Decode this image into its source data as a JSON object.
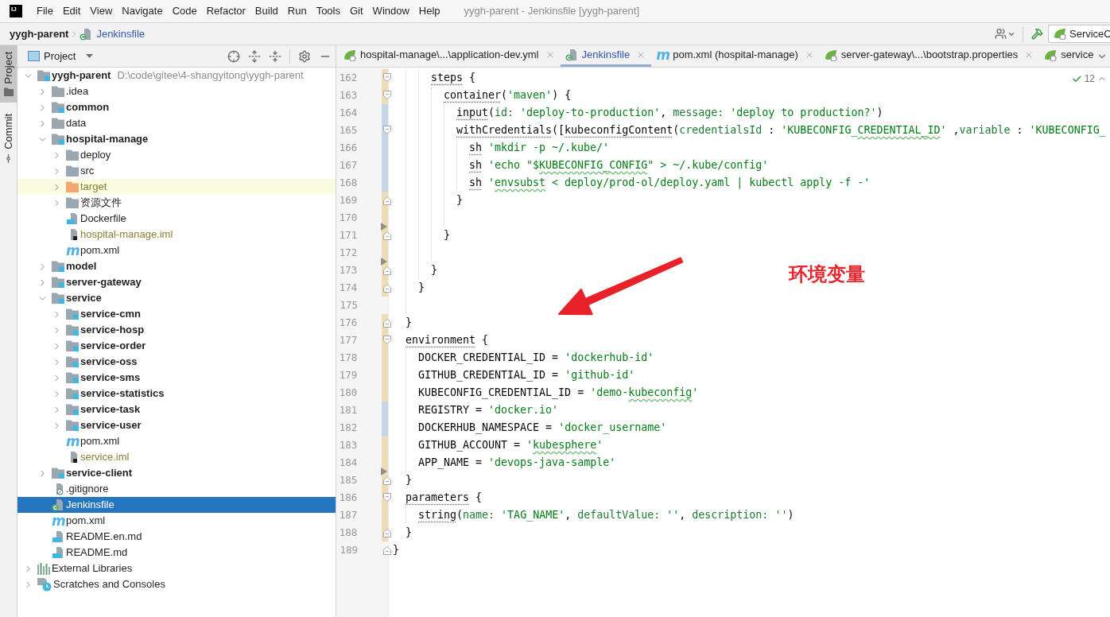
{
  "window": {
    "logo": "IJ",
    "title": "yygh-parent - Jenkinsfile [yygh-parent]"
  },
  "menu": [
    "File",
    "Edit",
    "View",
    "Navigate",
    "Code",
    "Refactor",
    "Build",
    "Run",
    "Tools",
    "Git",
    "Window",
    "Help"
  ],
  "breadcrumb": {
    "project": "yygh-parent",
    "file": {
      "label": "Jenkinsfile",
      "kind": "jenkins",
      "modified": true
    }
  },
  "run_config": {
    "label": "ServiceC"
  },
  "tool_windows": [
    {
      "label": "Project",
      "kind": "project",
      "selected": true
    },
    {
      "label": "Commit",
      "kind": "commit",
      "selected": false
    }
  ],
  "project_panel": {
    "title": "Project",
    "tree": [
      {
        "name": "yygh-parent",
        "path": "D:\\code\\gitee\\4-shangyitong\\yygh-parent",
        "kind": "module",
        "expanded": true,
        "selected": false,
        "ignored": false,
        "children": [
          {
            "name": ".idea",
            "kind": "folder",
            "expanded": false,
            "selected": false,
            "ignored": false
          },
          {
            "name": "common",
            "kind": "module",
            "expanded": false,
            "selected": false,
            "ignored": false
          },
          {
            "name": "data",
            "kind": "folder",
            "expanded": false,
            "selected": false,
            "ignored": false
          },
          {
            "name": "hospital-manage",
            "kind": "module",
            "expanded": true,
            "selected": false,
            "ignored": false,
            "children": [
              {
                "name": "deploy",
                "kind": "folder",
                "expanded": false,
                "selected": false,
                "ignored": false
              },
              {
                "name": "src",
                "kind": "folder",
                "expanded": false,
                "selected": false,
                "ignored": false
              },
              {
                "name": "target",
                "kind": "excluded",
                "expanded": false,
                "selected": false,
                "ignored": true
              },
              {
                "name": "资源文件",
                "kind": "folder",
                "expanded": false,
                "selected": false,
                "ignored": false
              },
              {
                "name": "Dockerfile",
                "kind": "dockerfile",
                "selected": false,
                "ignored": false
              },
              {
                "name": "hospital-manage.iml",
                "kind": "iml",
                "selected": false,
                "ignored": true
              },
              {
                "name": "pom.xml",
                "kind": "maven",
                "glyph": "m",
                "selected": false,
                "ignored": false
              }
            ]
          },
          {
            "name": "model",
            "kind": "module",
            "expanded": false,
            "selected": false,
            "ignored": false
          },
          {
            "name": "server-gateway",
            "kind": "module",
            "expanded": false,
            "selected": false,
            "ignored": false
          },
          {
            "name": "service",
            "kind": "module",
            "expanded": true,
            "selected": false,
            "ignored": false,
            "children": [
              {
                "name": "service-cmn",
                "kind": "module",
                "expanded": false,
                "selected": false,
                "ignored": false
              },
              {
                "name": "service-hosp",
                "kind": "module",
                "expanded": false,
                "selected": false,
                "ignored": false
              },
              {
                "name": "service-order",
                "kind": "module",
                "expanded": false,
                "selected": false,
                "ignored": false
              },
              {
                "name": "service-oss",
                "kind": "module",
                "expanded": false,
                "selected": false,
                "ignored": false
              },
              {
                "name": "service-sms",
                "kind": "module",
                "expanded": false,
                "selected": false,
                "ignored": false
              },
              {
                "name": "service-statistics",
                "kind": "module",
                "expanded": false,
                "selected": false,
                "ignored": false
              },
              {
                "name": "service-task",
                "kind": "module",
                "expanded": false,
                "selected": false,
                "ignored": false
              },
              {
                "name": "service-user",
                "kind": "module",
                "expanded": false,
                "selected": false,
                "ignored": false
              },
              {
                "name": "pom.xml",
                "kind": "maven",
                "glyph": "m",
                "selected": false,
                "ignored": false
              },
              {
                "name": "service.iml",
                "kind": "iml",
                "selected": false,
                "ignored": true
              }
            ]
          },
          {
            "name": "service-client",
            "kind": "module",
            "expanded": false,
            "selected": false,
            "ignored": false
          },
          {
            "name": ".gitignore",
            "kind": "gitignore",
            "selected": false,
            "ignored": false
          },
          {
            "name": "Jenkinsfile",
            "kind": "jenkins",
            "selected": true,
            "ignored": false
          },
          {
            "name": "pom.xml",
            "kind": "maven",
            "glyph": "m",
            "selected": false,
            "ignored": false
          },
          {
            "name": "README.en.md",
            "kind": "markdown",
            "selected": false,
            "ignored": false
          },
          {
            "name": "README.md",
            "kind": "markdown",
            "selected": false,
            "ignored": false
          }
        ]
      },
      {
        "name": "External Libraries",
        "kind": "libraries",
        "expanded": false,
        "selected": false,
        "ignored": false
      },
      {
        "name": "Scratches and Consoles",
        "kind": "scratches",
        "expanded": false,
        "selected": false,
        "ignored": false
      }
    ]
  },
  "editor": {
    "tabs": [
      {
        "label": "hospital-manage\\...\\application-dev.yml",
        "kind": "spring",
        "selected": false,
        "modified": false,
        "closable": true
      },
      {
        "label": "Jenkinsfile",
        "kind": "jenkins",
        "selected": true,
        "modified": true,
        "closable": true
      },
      {
        "label": "pom.xml (hospital-manage)",
        "kind": "maven",
        "glyph": "m",
        "selected": false,
        "modified": false,
        "closable": true
      },
      {
        "label": "server-gateway\\...\\bootstrap.properties",
        "kind": "spring",
        "selected": false,
        "modified": false,
        "closable": true
      },
      {
        "label": "service",
        "kind": "spring",
        "selected": false,
        "modified": false,
        "closable": false
      }
    ],
    "inspections": "12",
    "lines": [
      {
        "number": "162",
        "color": "#eddcb5",
        "fold": {
          "kind": "start"
        },
        "marker": false,
        "tokens": [
          {
            "kind": "keyword",
            "text": "      steps"
          },
          {
            "kind": "plain",
            "text": " {"
          }
        ]
      },
      {
        "number": "163",
        "color": "#eddcb5",
        "fold": {
          "kind": "start"
        },
        "marker": false,
        "tokens": [
          {
            "kind": "keyword",
            "text": "        container"
          },
          {
            "kind": "plain",
            "text": "("
          },
          {
            "kind": "string",
            "text": "'maven'"
          },
          {
            "kind": "plain",
            "text": ") {"
          }
        ]
      },
      {
        "number": "164",
        "color": "#c5d6e8",
        "marker": false,
        "tokens": [
          {
            "kind": "keyword",
            "text": "          input"
          },
          {
            "kind": "plain",
            "text": "("
          },
          {
            "kind": "param",
            "text": "id: "
          },
          {
            "kind": "string",
            "text": "'deploy-to-production'"
          },
          {
            "kind": "plain",
            "text": ", "
          },
          {
            "kind": "param",
            "text": "message: "
          },
          {
            "kind": "string",
            "text": "'deploy to production?'"
          },
          {
            "kind": "plain",
            "text": ")"
          }
        ]
      },
      {
        "number": "165",
        "color": "#c5d6e8",
        "fold": {
          "kind": "start"
        },
        "marker": false,
        "tokens": [
          {
            "kind": "keyword",
            "text": "          withCredentials"
          },
          {
            "kind": "plain",
            "text": "(["
          },
          {
            "kind": "keyword",
            "text": "kubeconfigContent"
          },
          {
            "kind": "plain",
            "text": "("
          },
          {
            "kind": "param",
            "text": "credentialsId"
          },
          {
            "kind": "plain",
            "text": " : "
          },
          {
            "kind": "string",
            "text": "'KUBECONFIG_"
          },
          {
            "kind": "typo",
            "text": "CREDENTIAL_ID"
          },
          {
            "kind": "string",
            "text": "'"
          },
          {
            "kind": "plain",
            "text": " ,"
          },
          {
            "kind": "param",
            "text": "variable"
          },
          {
            "kind": "plain",
            "text": " : "
          },
          {
            "kind": "string",
            "text": "'KUBECONFIG_"
          }
        ]
      },
      {
        "number": "166",
        "color": "#c5d6e8",
        "marker": false,
        "tokens": [
          {
            "kind": "keyword",
            "text": "            sh"
          },
          {
            "kind": "string",
            "text": " 'mkdir -p ~/.kube/'"
          }
        ]
      },
      {
        "number": "167",
        "color": "#c5d6e8",
        "marker": false,
        "tokens": [
          {
            "kind": "keyword",
            "text": "            sh"
          },
          {
            "kind": "string",
            "text": " 'echo \"$"
          },
          {
            "kind": "typo",
            "text": "KUBECONFIG_CONFIG"
          },
          {
            "kind": "string",
            "text": "\" > ~/.kube/config'"
          }
        ]
      },
      {
        "number": "168",
        "color": "#c5d6e8",
        "marker": false,
        "tokens": [
          {
            "kind": "keyword",
            "text": "            sh"
          },
          {
            "kind": "string",
            "text": " '"
          },
          {
            "kind": "typo",
            "text": "envsubst"
          },
          {
            "kind": "string",
            "text": " < deploy/prod-ol/deploy.yaml | kubectl apply -f -'"
          }
        ]
      },
      {
        "number": "169",
        "color": "#eddcb5",
        "fold": {
          "kind": "end"
        },
        "marker": false,
        "tokens": [
          {
            "kind": "plain",
            "text": "          }"
          }
        ]
      },
      {
        "number": "170",
        "color": "#eddcb5",
        "marker": false
      },
      {
        "number": "171",
        "color": "#eddcb5",
        "fold": {
          "kind": "end"
        },
        "marker": true,
        "tokens": [
          {
            "kind": "plain",
            "text": "        }"
          }
        ]
      },
      {
        "number": "172",
        "color": "#eddcb5",
        "marker": false
      },
      {
        "number": "173",
        "color": "#eddcb5",
        "fold": {
          "kind": "end"
        },
        "marker": true,
        "tokens": [
          {
            "kind": "plain",
            "text": "      }"
          }
        ]
      },
      {
        "number": "174",
        "color": "#eddcb5",
        "fold": {
          "kind": "end"
        },
        "marker": false,
        "tokens": [
          {
            "kind": "plain",
            "text": "    }"
          }
        ]
      },
      {
        "number": "175",
        "marker": false
      },
      {
        "number": "176",
        "color": "#eddcb5",
        "fold": {
          "kind": "end"
        },
        "marker": false,
        "tokens": [
          {
            "kind": "plain",
            "text": "  }"
          }
        ]
      },
      {
        "number": "177",
        "color": "#eddcb5",
        "fold": {
          "kind": "start"
        },
        "marker": false,
        "tokens": [
          {
            "kind": "keyword",
            "text": "  environment"
          },
          {
            "kind": "plain",
            "text": " {"
          }
        ]
      },
      {
        "number": "178",
        "color": "#eddcb5",
        "marker": false,
        "tokens": [
          {
            "kind": "plain",
            "text": "    DOCKER_CREDENTIAL_ID = "
          },
          {
            "kind": "string",
            "text": "'dockerhub-id'"
          }
        ]
      },
      {
        "number": "179",
        "color": "#eddcb5",
        "marker": false,
        "tokens": [
          {
            "kind": "plain",
            "text": "    GITHUB_CREDENTIAL_ID = "
          },
          {
            "kind": "string",
            "text": "'github-id'"
          }
        ]
      },
      {
        "number": "180",
        "color": "#eddcb5",
        "marker": false,
        "tokens": [
          {
            "kind": "plain",
            "text": "    KUBECONFIG_CREDENTIAL_ID = "
          },
          {
            "kind": "string",
            "text": "'demo-"
          },
          {
            "kind": "typo",
            "text": "kubeconfig"
          },
          {
            "kind": "string",
            "text": "'"
          }
        ]
      },
      {
        "number": "181",
        "color": "#c5d6e8",
        "marker": false,
        "tokens": [
          {
            "kind": "plain",
            "text": "    REGISTRY = "
          },
          {
            "kind": "string",
            "text": "'docker.io'"
          }
        ]
      },
      {
        "number": "182",
        "color": "#c5d6e8",
        "marker": false,
        "tokens": [
          {
            "kind": "plain",
            "text": "    DOCKERHUB_NAMESPACE = "
          },
          {
            "kind": "string",
            "text": "'docker_username'"
          }
        ]
      },
      {
        "number": "183",
        "color": "#eddcb5",
        "marker": false,
        "tokens": [
          {
            "kind": "plain",
            "text": "    GITHUB_ACCOUNT = "
          },
          {
            "kind": "string",
            "text": "'"
          },
          {
            "kind": "typo",
            "text": "kubesphere"
          },
          {
            "kind": "string",
            "text": "'"
          }
        ]
      },
      {
        "number": "184",
        "color": "#eddcb5",
        "marker": false,
        "tokens": [
          {
            "kind": "plain",
            "text": "    APP_NAME = "
          },
          {
            "kind": "string",
            "text": "'devops-java-sample'"
          }
        ]
      },
      {
        "number": "185",
        "color": "#eddcb5",
        "fold": {
          "kind": "end"
        },
        "marker": true,
        "tokens": [
          {
            "kind": "plain",
            "text": "  }"
          }
        ]
      },
      {
        "number": "186",
        "color": "#eddcb5",
        "fold": {
          "kind": "start"
        },
        "marker": false,
        "tokens": [
          {
            "kind": "keyword",
            "text": "  parameters"
          },
          {
            "kind": "plain",
            "text": " {"
          }
        ]
      },
      {
        "number": "187",
        "color": "#eddcb5",
        "marker": false,
        "tokens": [
          {
            "kind": "keyword",
            "text": "    string"
          },
          {
            "kind": "plain",
            "text": "("
          },
          {
            "kind": "param",
            "text": "name: "
          },
          {
            "kind": "string",
            "text": "'TAG_NAME'"
          },
          {
            "kind": "plain",
            "text": ", "
          },
          {
            "kind": "param",
            "text": "defaultValue: "
          },
          {
            "kind": "string",
            "text": "''"
          },
          {
            "kind": "plain",
            "text": ", "
          },
          {
            "kind": "param",
            "text": "description: "
          },
          {
            "kind": "string",
            "text": "''"
          },
          {
            "kind": "plain",
            "text": ")"
          }
        ]
      },
      {
        "number": "188",
        "color": "#eddcb5",
        "fold": {
          "kind": "end"
        },
        "marker": false,
        "tokens": [
          {
            "kind": "plain",
            "text": "  }"
          }
        ]
      },
      {
        "number": "189",
        "fold": {
          "kind": "end"
        },
        "marker": false,
        "tokens": [
          {
            "kind": "plain",
            "text": "}"
          }
        ]
      }
    ]
  },
  "annotation": {
    "label": "环境变量"
  }
}
